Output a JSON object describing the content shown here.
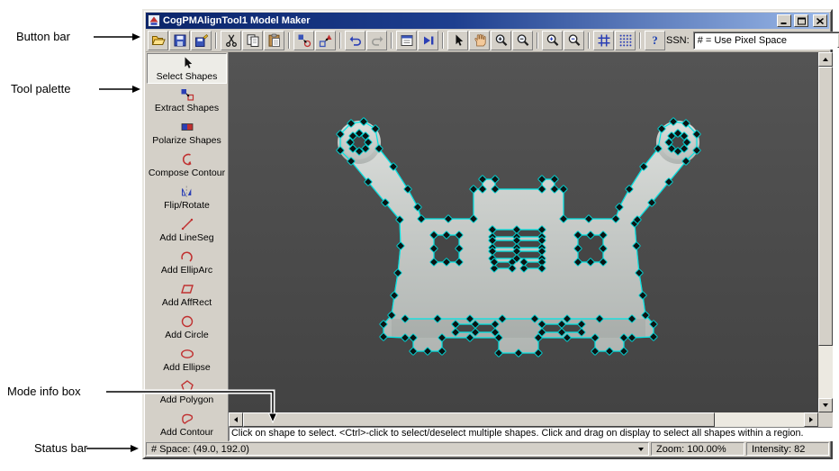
{
  "annotations": {
    "button_bar": "Button bar",
    "tool_palette": "Tool palette",
    "mode_info_box": "Mode info box",
    "status_bar": "Status bar"
  },
  "window": {
    "title": "CogPMAlignTool1 Model Maker"
  },
  "toolbar": {
    "ssn_label": "SSN:",
    "ssn_value": "# = Use Pixel Space",
    "help_glyph": "?"
  },
  "palette": {
    "items": [
      {
        "label": "Select Shapes"
      },
      {
        "label": "Extract Shapes"
      },
      {
        "label": "Polarize Shapes"
      },
      {
        "label": "Compose Contour"
      },
      {
        "label": "Flip/Rotate"
      },
      {
        "label": "Add LineSeg"
      },
      {
        "label": "Add EllipArc"
      },
      {
        "label": "Add AffRect"
      },
      {
        "label": "Add Circle"
      },
      {
        "label": "Add Ellipse"
      },
      {
        "label": "Add Polygon"
      },
      {
        "label": "Add Contour"
      }
    ]
  },
  "mode_info": {
    "text": "Click on shape to select. <Ctrl>-click to select/deselect multiple shapes. Click and drag on display to select all shapes within a region."
  },
  "statusbar": {
    "space": "# Space:  (49.0, 192.0)",
    "zoom": "Zoom:  100.00%",
    "intensity": "Intensity: 82"
  }
}
